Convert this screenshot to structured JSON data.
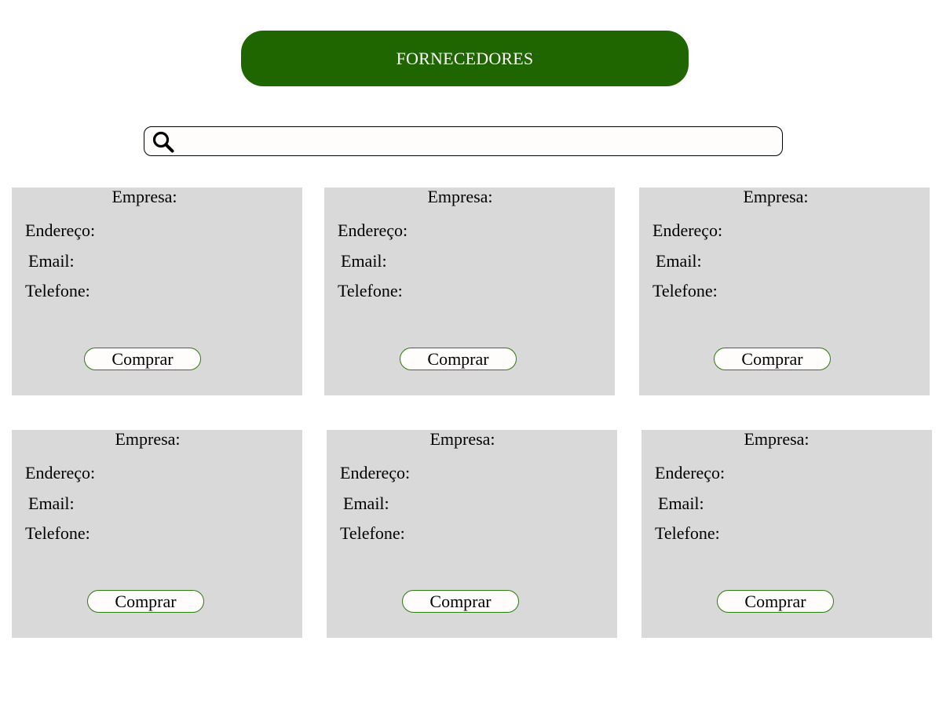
{
  "header": {
    "title": "FORNECEDORES",
    "background_color": "#1f6600"
  },
  "search": {
    "icon": "search-icon",
    "value": "",
    "placeholder": ""
  },
  "cards": [
    {
      "company_label": "Empresa:",
      "address_label": "Endereço:",
      "email_label": "Email:",
      "phone_label": "Telefone:",
      "buy_label": "Comprar"
    },
    {
      "company_label": "Empresa:",
      "address_label": "Endereço:",
      "email_label": "Email:",
      "phone_label": "Telefone:",
      "buy_label": "Comprar"
    },
    {
      "company_label": "Empresa:",
      "address_label": "Endereço:",
      "email_label": "Email:",
      "phone_label": "Telefone:",
      "buy_label": "Comprar"
    },
    {
      "company_label": "Empresa:",
      "address_label": "Endereço:",
      "email_label": "Email:",
      "phone_label": "Telefone:",
      "buy_label": "Comprar"
    },
    {
      "company_label": "Empresa:",
      "address_label": "Endereço:",
      "email_label": "Email:",
      "phone_label": "Telefone:",
      "buy_label": "Comprar"
    },
    {
      "company_label": "Empresa:",
      "address_label": "Endereço:",
      "email_label": "Email:",
      "phone_label": "Telefone:",
      "buy_label": "Comprar"
    }
  ],
  "colors": {
    "card_background": "#d9d9d9",
    "button_border": "#2e7d12",
    "button_background": "#fffcfc"
  }
}
